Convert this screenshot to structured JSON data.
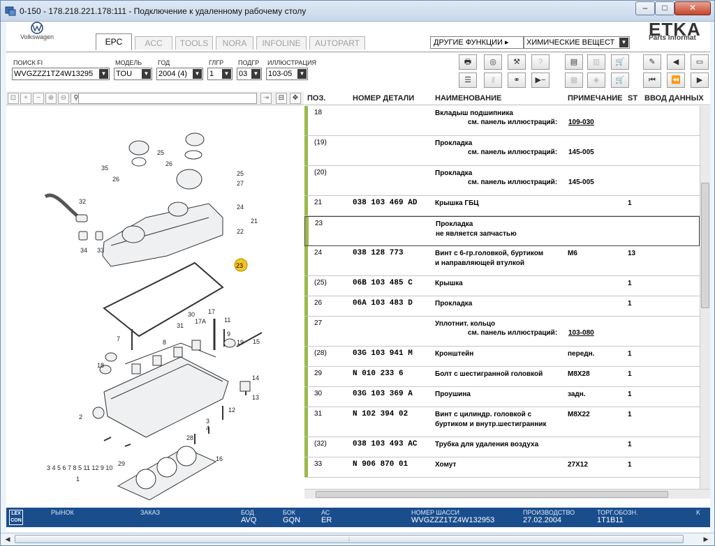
{
  "window": {
    "title": "0-150 - 178.218.221.178:111 - Подключение к удаленному рабочему столу",
    "min": "–",
    "max": "□",
    "close": "✕"
  },
  "header": {
    "brand": "Volkswagen",
    "tabs": [
      "EPC",
      "ACC",
      "TOOLS",
      "NORA",
      "INFOLINE",
      "AUTOPART"
    ],
    "active_tab": "EPC",
    "other_functions": "ДРУГИЕ ФУНКЦИИ ▸",
    "chem_select": "ХИМИЧЕСКИЕ ВЕЩЕСТ",
    "etka": "ETKA",
    "etka_sub": "Parts Informat"
  },
  "filters": {
    "search_fi_label": "ПОИСК FI",
    "search_fi": "WVGZZZ1TZ4W13295",
    "model_label": "МОДЕЛЬ",
    "model": "TOU",
    "year_label": "ГОД",
    "year": "2004 (4)",
    "main_group_label": "ГЛГР",
    "main_group": "1",
    "sub_group_label": "ПОДГР",
    "sub_group": "03",
    "illustration_label": "ИЛЛЮСТРАЦИЯ",
    "illustration": "103-05"
  },
  "table": {
    "headers": {
      "pos": "ПОЗ.",
      "part_no": "НОМЕР ДЕТАЛИ",
      "name": "НАИМЕНОВАНИЕ",
      "note": "ПРИМЕЧАНИЕ",
      "st": "ST",
      "input": "ВВОД ДАННЫХ"
    },
    "rows": [
      {
        "pos": "18",
        "part": "",
        "name1": "Вкладыш подшипника",
        "name2": "",
        "ref_label": "см. панель иллюстраций:",
        "ref": "109-030",
        "ref_link": true,
        "note": "",
        "st": ""
      },
      {
        "pos": "(19)",
        "part": "",
        "name1": "Прокладка",
        "name2": "",
        "ref_label": "см. панель иллюстраций:",
        "ref": "145-005",
        "ref_link": false,
        "note": "",
        "st": ""
      },
      {
        "pos": "(20)",
        "part": "",
        "name1": "Прокладка",
        "name2": "",
        "ref_label": "см. панель иллюстраций:",
        "ref": "145-005",
        "ref_link": false,
        "note": "",
        "st": ""
      },
      {
        "pos": "21",
        "part": "038 103 469 AD",
        "name1": "Крышка ГБЦ",
        "name2": "",
        "ref_label": "",
        "ref": "",
        "ref_link": false,
        "note": "",
        "st": "1"
      },
      {
        "pos": "23",
        "part": "",
        "name1": "Прокладка",
        "name2": "не является запчастью",
        "ref_label": "",
        "ref": "",
        "ref_link": false,
        "note": "",
        "st": ""
      },
      {
        "pos": "24",
        "part": "038 128 773",
        "name1": "Винт с 6-гр.головкой, буртиком",
        "name2": "и направляющей втулкой",
        "ref_label": "",
        "ref": "",
        "ref_link": false,
        "note": "M6",
        "st": "13"
      },
      {
        "pos": "(25)",
        "part": "06B 103 485 C",
        "name1": "Крышка",
        "name2": "",
        "ref_label": "",
        "ref": "",
        "ref_link": false,
        "note": "",
        "st": "1"
      },
      {
        "pos": "26",
        "part": "06A 103 483 D",
        "name1": "Прокладка",
        "name2": "",
        "ref_label": "",
        "ref": "",
        "ref_link": false,
        "note": "",
        "st": "1"
      },
      {
        "pos": "27",
        "part": "",
        "name1": "Уплотнит. кольцо",
        "name2": "",
        "ref_label": "см. панель иллюстраций:",
        "ref": "103-080",
        "ref_link": true,
        "note": "",
        "st": ""
      },
      {
        "pos": "(28)",
        "part": "03G 103 941 M",
        "name1": "Кронштейн",
        "name2": "",
        "ref_label": "",
        "ref": "",
        "ref_link": false,
        "note": "передн.",
        "st": "1"
      },
      {
        "pos": "29",
        "part": "N    010 233 6",
        "name1": "Болт с шестигранной головкой",
        "name2": "",
        "ref_label": "",
        "ref": "",
        "ref_link": false,
        "note": "M8X28",
        "st": "1"
      },
      {
        "pos": "30",
        "part": "03G 103 369 A",
        "name1": "Проушина",
        "name2": "",
        "ref_label": "",
        "ref": "",
        "ref_link": false,
        "note": "задн.",
        "st": "1"
      },
      {
        "pos": "31",
        "part": "N    102 394 02",
        "name1": "Винт с цилиндр. головкой с",
        "name2": "буртиком и внутр.шестигранник",
        "ref_label": "",
        "ref": "",
        "ref_link": false,
        "note": "M8X22",
        "st": "1"
      },
      {
        "pos": "(32)",
        "part": "038 103 493 AC",
        "name1": "Трубка для удаления воздуха",
        "name2": "",
        "ref_label": "",
        "ref": "",
        "ref_link": false,
        "note": "",
        "st": "1"
      },
      {
        "pos": "33",
        "part": "N    906 870 01",
        "name1": "Хомут",
        "name2": "",
        "ref_label": "",
        "ref": "",
        "ref_link": false,
        "note": "27X12",
        "st": "1"
      }
    ]
  },
  "diagram": {
    "callouts": [
      "35",
      "26",
      "25",
      "26",
      "25",
      "27",
      "32",
      "24",
      "21",
      "22",
      "34",
      "33",
      "23",
      "30",
      "31",
      "17A",
      "17",
      "11",
      "7",
      "8",
      "9",
      "19",
      "15",
      "18",
      "14",
      "13",
      "10",
      "12",
      "2",
      "3",
      "4",
      "28",
      "5",
      "6",
      "7",
      "8",
      "29",
      "16",
      "34",
      "11",
      "12",
      "9",
      "1"
    ],
    "bottom_label": "3 4 5 6 7 8   5  11 12 9 10"
  },
  "status": {
    "logo": "LEX CON",
    "market_label": "РЫНОК",
    "order_label": "ЗАКАЗ",
    "bod_label": "БОД",
    "bod": "AVQ",
    "bok_label": "БОК",
    "bok": "GQN",
    "ac_label": "АС",
    "ac": "ER",
    "chassis_label": "НОМЕР ШАССИ",
    "chassis": "WVGZZZ1TZ4W132953",
    "prod_label": "ПРОИЗВОДСТВО",
    "prod": "27.02.2004",
    "trade_label": "ТОРГ.ОБОЗН.",
    "trade": "1T1B11",
    "k": "K"
  },
  "colors": {
    "status_bg": "#1a4d8c",
    "row_accent": "#9cb94a",
    "callout": "#f3c521"
  }
}
